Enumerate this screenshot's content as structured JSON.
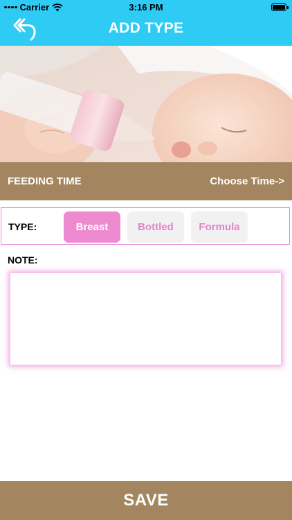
{
  "status_bar": {
    "carrier": "Carrier",
    "time": "3:16 PM"
  },
  "nav": {
    "title": "ADD TYPE",
    "back_icon": "back-arrow-icon"
  },
  "hero": {
    "image": "sleeping-baby-with-bottle-photo"
  },
  "feeding": {
    "label": "FEEDING TIME",
    "choose_label": "Choose Time->"
  },
  "type": {
    "label": "TYPE:",
    "options": [
      "Breast",
      "Bottled",
      "Formula"
    ],
    "selected": "Breast"
  },
  "note": {
    "label": "NOTE:",
    "value": ""
  },
  "save": {
    "label": "SAVE"
  },
  "colors": {
    "nav": "#2ecbf5",
    "bar": "#a3855f",
    "accent_pink": "#ee8bd0",
    "pink_text": "#e583cc",
    "unselected_bg": "#f1f1f1"
  }
}
